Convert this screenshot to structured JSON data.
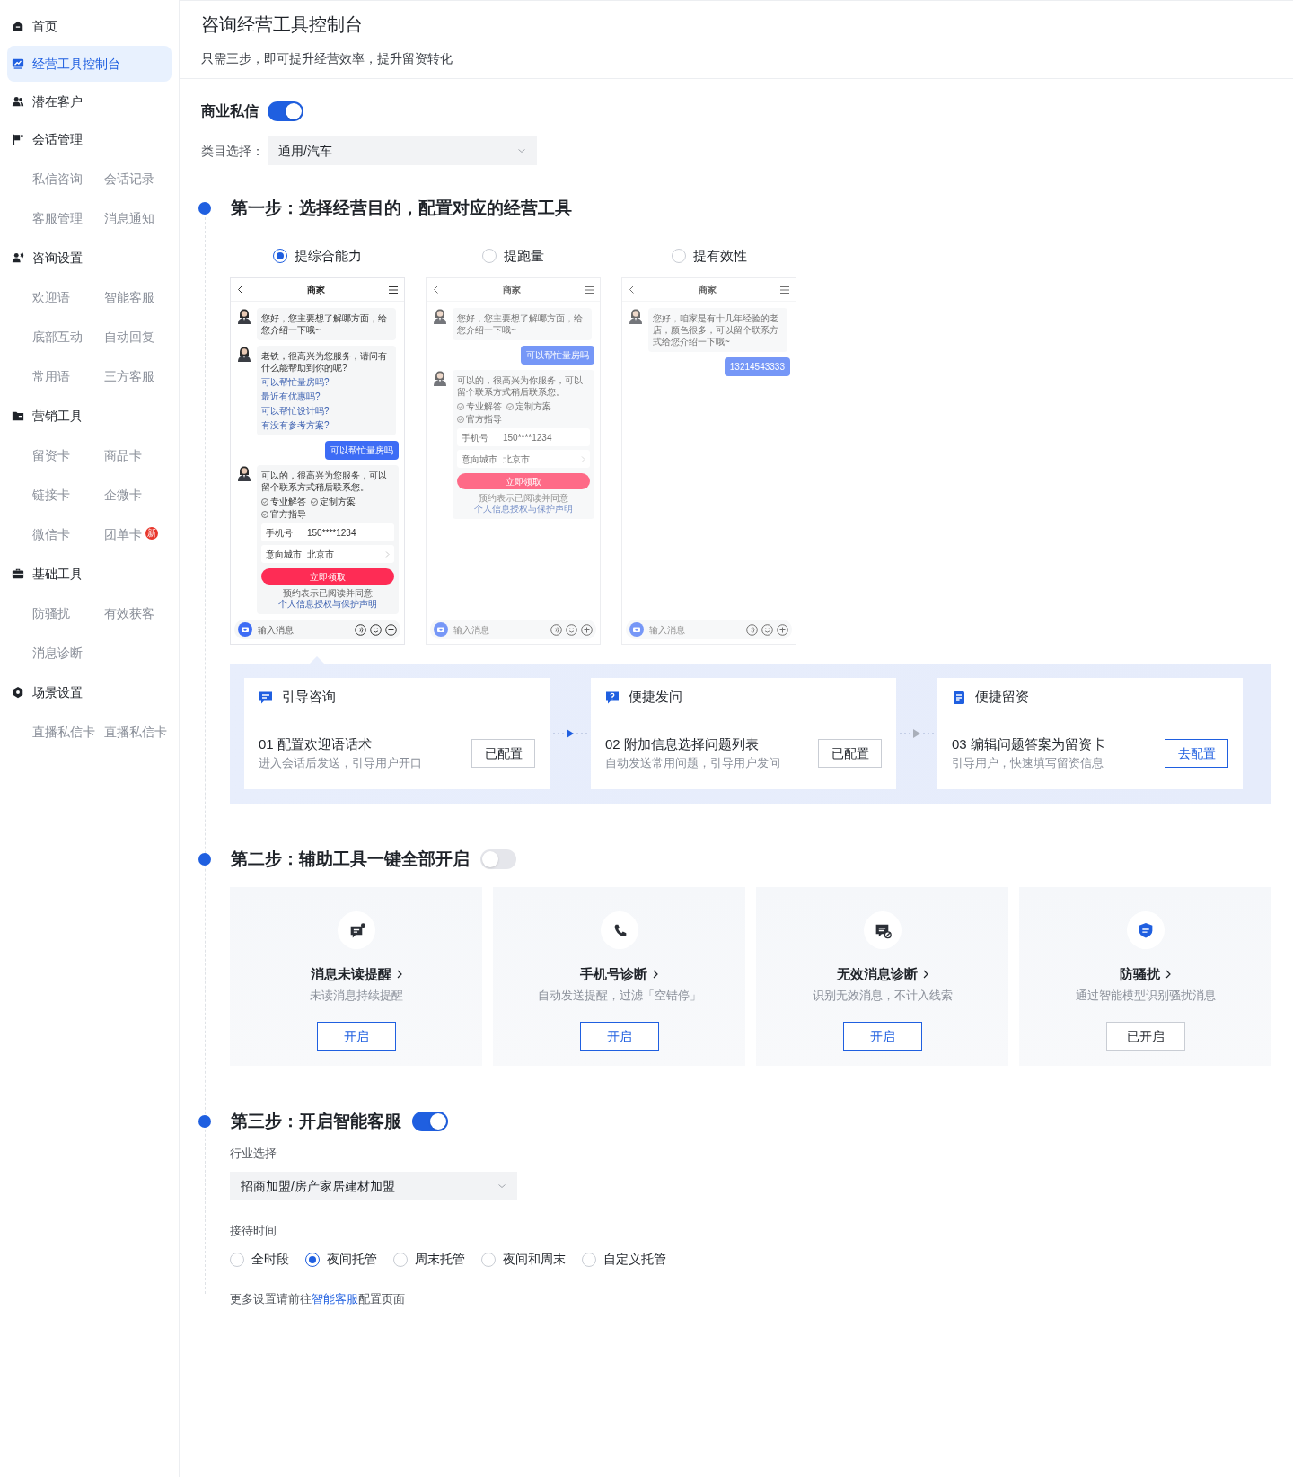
{
  "sidebar": {
    "items": [
      {
        "label": "首页",
        "selected": false
      },
      {
        "label": "经营工具控制台",
        "selected": true
      },
      {
        "label": "潜在客户",
        "selected": false
      },
      {
        "label": "会话管理",
        "selected": false,
        "children": [
          {
            "label": "私信咨询",
            "selected": false
          },
          {
            "label": "会话记录",
            "selected": false
          },
          {
            "label": "客服管理",
            "selected": false
          },
          {
            "label": "消息通知",
            "selected": false
          }
        ]
      },
      {
        "label": "咨询设置",
        "selected": false,
        "children": [
          {
            "label": "欢迎语",
            "selected": false
          },
          {
            "label": "智能客服",
            "selected": false
          },
          {
            "label": "底部互动",
            "selected": false
          },
          {
            "label": "自动回复",
            "selected": false
          },
          {
            "label": "常用语",
            "selected": false
          },
          {
            "label": "三方客服",
            "selected": false
          }
        ]
      },
      {
        "label": "营销工具",
        "selected": false,
        "children": [
          {
            "label": "留资卡",
            "selected": false
          },
          {
            "label": "商品卡",
            "selected": false
          },
          {
            "label": "链接卡",
            "selected": false
          },
          {
            "label": "企微卡",
            "selected": false
          },
          {
            "label": "微信卡",
            "selected": false
          },
          {
            "label": "团单卡",
            "selected": false,
            "badge": "新"
          }
        ]
      },
      {
        "label": "基础工具",
        "selected": false,
        "children": [
          {
            "label": "防骚扰",
            "selected": false
          },
          {
            "label": "有效获客",
            "selected": false
          },
          {
            "label": "消息诊断",
            "selected": false
          }
        ]
      },
      {
        "label": "场景设置",
        "selected": false,
        "children": [
          {
            "label": "直播私信卡",
            "selected": false
          },
          {
            "label": "直播私信卡",
            "selected": false
          }
        ]
      }
    ]
  },
  "header": {
    "title": "咨询经营工具控制台",
    "subtitle": "只需三步，即可提升经营效率，提升留资转化"
  },
  "business_dm": {
    "label": "商业私信",
    "on": true
  },
  "category": {
    "label": "类目选择：",
    "value": "通用/汽车"
  },
  "step1": {
    "title": "第一步：选择经营目的，配置对应的经营工具",
    "options": [
      {
        "label": "提综合能力",
        "selected": true,
        "phone": {
          "title": "商家",
          "input_placeholder": "输入消息",
          "messages": [
            {
              "kind": "bot",
              "text": "您好，您主要想了解哪方面，给您介绍一下哦~"
            },
            {
              "kind": "bot",
              "text": "老铁，很高兴为您服务，请问有什么能帮助到你的呢?",
              "links": [
                "可以帮忙量房吗?",
                "最近有优惠吗?",
                "可以帮忙设计吗?",
                "有没有参考方案?"
              ]
            },
            {
              "kind": "user",
              "text": "可以帮忙量房吗"
            },
            {
              "kind": "form",
              "text": "可以的，很高兴为您服务，可以留个联系方式稍后联系您。",
              "checks": [
                "专业解答",
                "定制方案",
                "官方指导"
              ],
              "fields": [
                {
                  "label": "手机号",
                  "value": "150****1234",
                  "arrow": false
                },
                {
                  "label": "意向城市",
                  "value": "北京市",
                  "arrow": true
                }
              ],
              "button": "立即领取",
              "note": "预约表示已阅读并同意",
              "note_link": "个人信息授权与保护声明"
            }
          ]
        }
      },
      {
        "label": "提跑量",
        "selected": false,
        "phone": {
          "title": "商家",
          "input_placeholder": "输入消息",
          "messages": [
            {
              "kind": "bot",
              "text": "您好，您主要想了解哪方面，给您介绍一下哦~"
            },
            {
              "kind": "user",
              "text": "可以帮忙量房吗"
            },
            {
              "kind": "form",
              "text": "可以的，很高兴为你服务，可以留个联系方式稍后联系您。",
              "checks": [
                "专业解答",
                "定制方案",
                "官方指导"
              ],
              "fields": [
                {
                  "label": "手机号",
                  "value": "150****1234",
                  "arrow": false
                },
                {
                  "label": "意向城市",
                  "value": "北京市",
                  "arrow": true
                }
              ],
              "button": "立即领取",
              "note": "预约表示已阅读并同意",
              "note_link": "个人信息授权与保护声明"
            }
          ]
        }
      },
      {
        "label": "提有效性",
        "selected": false,
        "phone": {
          "title": "商家",
          "input_placeholder": "输入消息",
          "messages": [
            {
              "kind": "bot",
              "text": "您好，咱家是有十几年经验的老店，颜色很多，可以留个联系方式给您介绍一下哦~"
            },
            {
              "kind": "user",
              "text": "13214543333"
            }
          ]
        }
      }
    ],
    "flow": [
      {
        "heading": "引导咨询",
        "title": "01 配置欢迎语话术",
        "desc": "进入会话后发送，引导用户开口",
        "button": "已配置",
        "configured": true
      },
      {
        "heading": "便捷发问",
        "title": "02 附加信息选择问题列表",
        "desc": "自动发送常用问题，引导用户发问",
        "button": "已配置",
        "configured": true
      },
      {
        "heading": "便捷留资",
        "title": "03 编辑问题答案为留资卡",
        "desc": "引导用户，快速填写留资信息",
        "button": "去配置",
        "configured": false
      }
    ]
  },
  "step2": {
    "title": "第二步：辅助工具一键全部开启",
    "on": false,
    "tools": [
      {
        "title": "消息未读提醒",
        "desc": "未读消息持续提醒",
        "button": "开启",
        "enabled": false
      },
      {
        "title": "手机号诊断",
        "desc": "自动发送提醒，过滤「空错停」",
        "button": "开启",
        "enabled": false
      },
      {
        "title": "无效消息诊断",
        "desc": "识别无效消息，不计入线索",
        "button": "开启",
        "enabled": false
      },
      {
        "title": "防骚扰",
        "desc": "通过智能模型识别骚扰消息",
        "button": "已开启",
        "enabled": true
      }
    ]
  },
  "step3": {
    "title": "第三步：开启智能客服",
    "on": true,
    "industry_label": "行业选择",
    "industry": "招商加盟/房产家居建材加盟",
    "time_label": "接待时间",
    "time_options": [
      {
        "label": "全时段",
        "selected": false
      },
      {
        "label": "夜间托管",
        "selected": true
      },
      {
        "label": "周末托管",
        "selected": false
      },
      {
        "label": "夜间和周末",
        "selected": false
      },
      {
        "label": "自定义托管",
        "selected": false
      }
    ],
    "hint": {
      "before": "更多设置请前往",
      "link": "智能客服",
      "after": "配置页面"
    }
  }
}
